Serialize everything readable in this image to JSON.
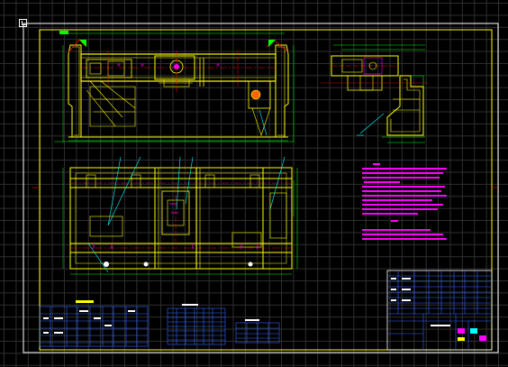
{
  "viewport": {
    "background": "#000000",
    "grid_color": "#2f2f2f",
    "ucs_icon": "ucs-icon"
  },
  "colors": {
    "frame_outer": "#ffffff",
    "frame_inner": "#ffff00",
    "primary": "#ffff00",
    "dimension": "#00ff00",
    "centerline": "#ff0000",
    "leader": "#00ffff",
    "annotation": "#ff00ff",
    "table_grid": "#3366ff",
    "hatch": "#ffffff"
  },
  "drawing": {
    "type": "mechanical assembly drawing (crane trolley frame)",
    "views": [
      "front-elevation-view",
      "side-elevation-view",
      "plan-view"
    ]
  }
}
